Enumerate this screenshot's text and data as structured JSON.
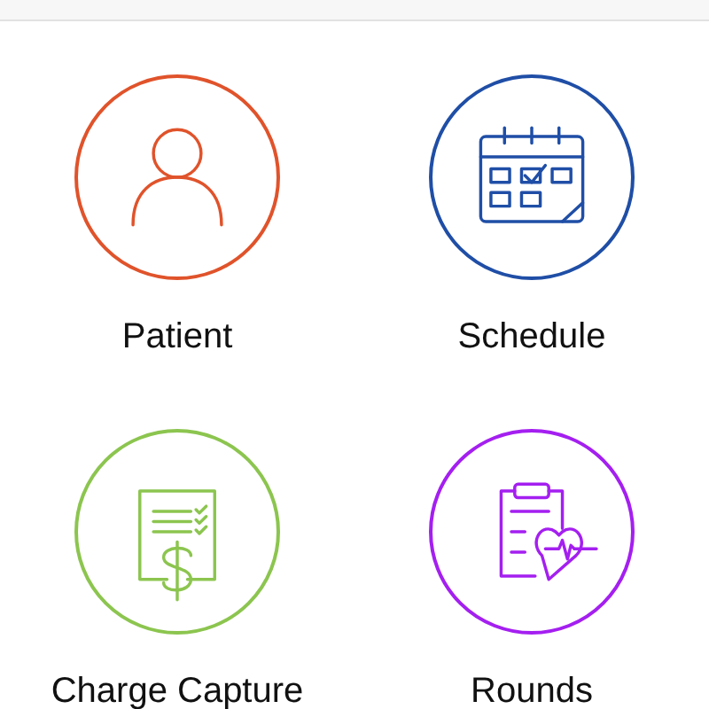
{
  "tiles": [
    {
      "kind": "patient",
      "label": "Patient",
      "color": "#e0532b"
    },
    {
      "kind": "schedule",
      "label": "Schedule",
      "color": "#1f4ea6"
    },
    {
      "kind": "charge",
      "label": "Charge Capture",
      "color": "#8cc54f"
    },
    {
      "kind": "rounds",
      "label": "Rounds",
      "color": "#a41ff0"
    }
  ]
}
